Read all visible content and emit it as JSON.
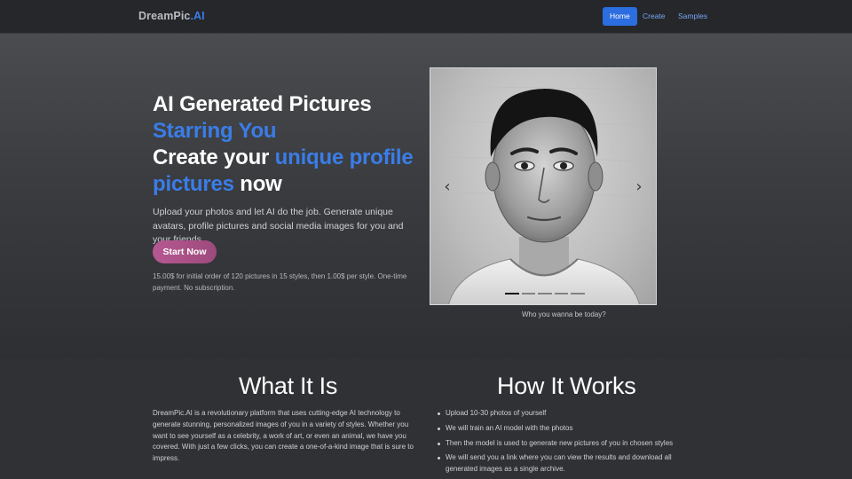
{
  "nav": {
    "brand_prefix": "DreamPic",
    "brand_suffix": ".AI",
    "links": [
      {
        "label": "Home",
        "active": true
      },
      {
        "label": "Create",
        "active": false
      },
      {
        "label": "Samples",
        "active": false
      }
    ]
  },
  "hero": {
    "title_line1": "AI Generated Pictures",
    "title_accent1": "Starring You",
    "title_line3_start": "Create your ",
    "title_accent2": "unique profile pictures",
    "title_line4_end": " now",
    "description": "Upload your photos and let AI do the job. Generate unique avatars, profile pictures and social media images for you and your friends.",
    "cta_label": "Start Now",
    "price_note": "15.00$ for initial order of 120 pictures in 15 styles, then 1.00$ per style. One-time payment. No subscription."
  },
  "carousel": {
    "caption": "Who you wanna be today?",
    "prev_icon": "chevron-left-icon",
    "next_icon": "chevron-right-icon",
    "slide_count": 5,
    "active_index": 0
  },
  "what_it_is": {
    "title": "What It Is",
    "text": "DreamPic.AI is a revolutionary platform that uses cutting-edge AI technology to generate stunning, personalized images of you in a variety of styles. Whether you want to see yourself as a celebrity, a work of art, or even an animal, we have you covered. With just a few clicks, you can create a one-of-a-kind image that is sure to impress."
  },
  "how_it_works": {
    "title": "How It Works",
    "steps": [
      "Upload 10-30 photos of yourself",
      "We will train an AI model with the photos",
      "Then the model is used to generate new pictures of you in chosen styles",
      "We will send you a link where you can view the results and download all generated images as a single archive."
    ]
  },
  "colors": {
    "accent": "#3a7de8",
    "nav_active": "#2c6ddf",
    "cta": "#b65892"
  }
}
